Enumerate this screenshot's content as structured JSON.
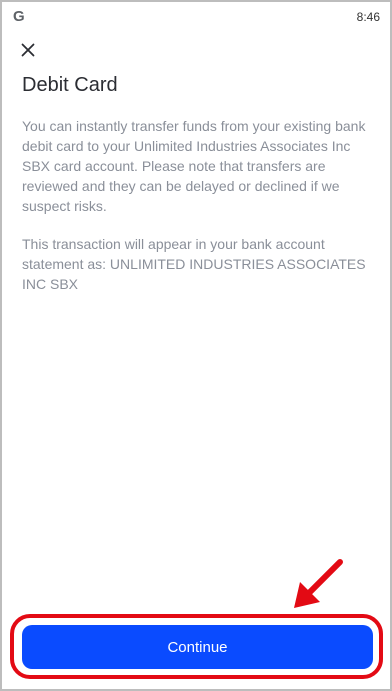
{
  "status_bar": {
    "app_logo": "G",
    "time": "8:46"
  },
  "icons": {
    "close": "close-icon",
    "annotation": "arrow-icon"
  },
  "header": {
    "title": "Debit Card"
  },
  "body": {
    "paragraph_1": "You can instantly transfer funds from your existing bank debit card to your Unlimited Industries Associates Inc SBX card account. Please note that transfers are reviewed and they can be delayed or declined if we suspect risks.",
    "paragraph_2": "This transaction will appear in your bank account statement as: UNLIMITED INDUSTRIES ASSOCIATES INC SBX"
  },
  "actions": {
    "continue_label": "Continue"
  },
  "colors": {
    "primary_button": "#0a4bff",
    "annotation": "#e30a14",
    "body_text": "#8a8f99",
    "title_text": "#2b2d33"
  }
}
